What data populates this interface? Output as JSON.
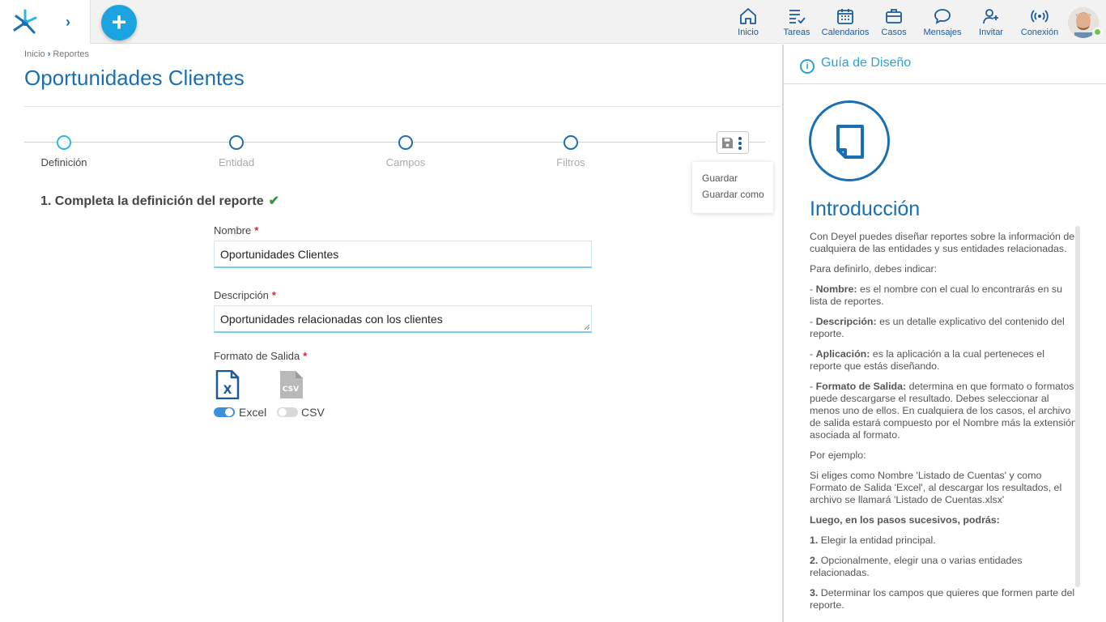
{
  "topbar": {
    "nav": [
      {
        "label": "Inicio",
        "icon": "home-icon"
      },
      {
        "label": "Tareas",
        "icon": "tasks-icon"
      },
      {
        "label": "Calendarios",
        "icon": "calendar-icon"
      },
      {
        "label": "Casos",
        "icon": "briefcase-icon"
      },
      {
        "label": "Mensajes",
        "icon": "chat-icon"
      },
      {
        "label": "Invitar",
        "icon": "add-user-icon"
      },
      {
        "label": "Conexión",
        "icon": "broadcast-icon"
      }
    ],
    "fab_label": "+"
  },
  "breadcrumb": {
    "home": "Inicio",
    "current": "Reportes"
  },
  "page": {
    "title": "Oportunidades Clientes"
  },
  "steps": [
    {
      "label": "Definición",
      "active": true
    },
    {
      "label": "Entidad",
      "active": false
    },
    {
      "label": "Campos",
      "active": false
    },
    {
      "label": "Filtros",
      "active": false
    }
  ],
  "save_menu": {
    "save": "Guardar",
    "save_as": "Guardar como"
  },
  "section": {
    "title": "1. Completa la definición del reporte"
  },
  "form": {
    "name_label": "Nombre",
    "name_value": "Oportunidades Clientes",
    "desc_label": "Descripción",
    "desc_value": "Oportunidades relacionadas con los clientes",
    "format_label": "Formato de Salida",
    "formats": [
      {
        "label": "Excel",
        "enabled": true,
        "icon": "excel-file-icon"
      },
      {
        "label": "CSV",
        "enabled": false,
        "icon": "csv-file-icon"
      }
    ]
  },
  "guide": {
    "title": "Guía de Diseño",
    "intro_title": "Introducción",
    "p1": "Con Deyel puedes diseñar reportes sobre la información de cualquiera de las entidades y sus entidades relacionadas.",
    "p2": "Para definirlo, debes indicar:",
    "nombre_term": "Nombre:",
    "nombre_desc": " es el nombre con el cual lo encontrarás en su lista de reportes.",
    "desc_term": "Descripción:",
    "desc_desc": " es un detalle explicativo del contenido del reporte.",
    "app_term": "Aplicación:",
    "app_desc": " es la aplicación a la cual perteneces el reporte que estás diseñando.",
    "fmt_term": "Formato de Salida:",
    "fmt_desc": " determina en que formato o formatos puede descargarse el resultado. Debes seleccionar al menos uno de ellos. En cualquiera de los casos, el archivo de salida estará compuesto por el Nombre más la extensión asociada al formato.",
    "example_label": "Por ejemplo:",
    "example_text": "Si eliges como Nombre 'Listado de Cuentas' y como Formato de Salida 'Excel', al descargar los resultados, el archivo se llamará 'Listado de Cuentas.xlsx'",
    "next_steps": "Luego, en los pasos sucesivos, podrás:",
    "s1_num": "1.",
    "s1": " Elegir la entidad principal.",
    "s2_num": "2.",
    "s2": " Opcionalmente, elegir una o varias entidades relacionadas.",
    "s3_num": "3.",
    "s3": " Determinar los campos que quieres que formen parte del reporte."
  },
  "colors": {
    "brand": "#1a6fb3",
    "accent": "#1aa3e0",
    "required": "#d3272c",
    "success": "#2e9a3a"
  }
}
